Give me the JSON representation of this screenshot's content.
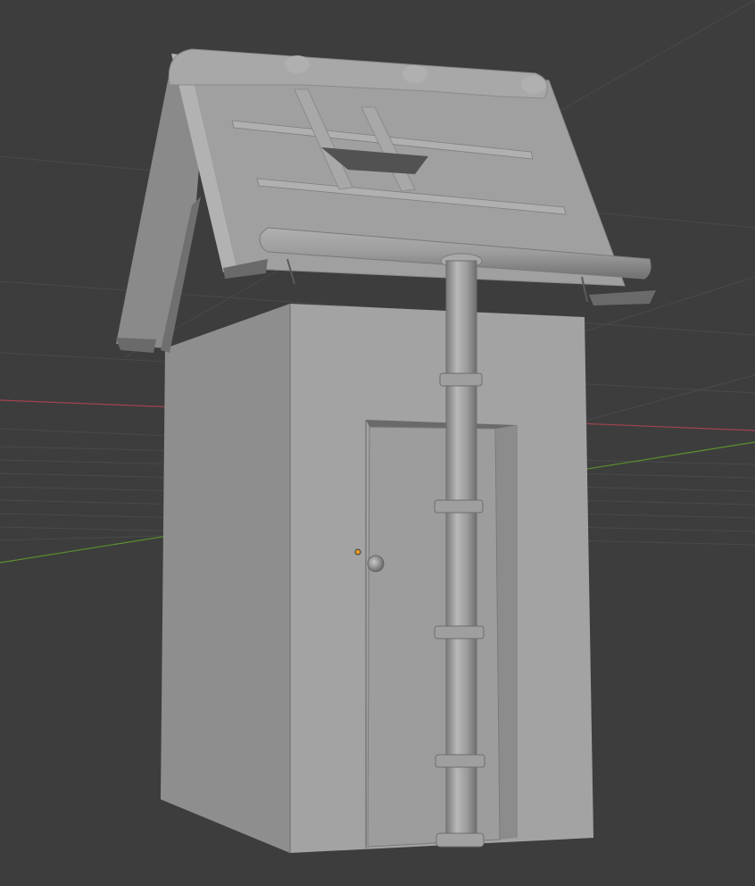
{
  "viewport": {
    "mode": "solid",
    "background_color": "#3d3d3d",
    "grid_color": "#4a4a4a",
    "x_axis_color": "#a0444f",
    "y_axis_color": "#5c8f2e",
    "origin_color": "#e79a23"
  },
  "object": {
    "name": "outhouse",
    "parts": [
      "roof",
      "roof-planks",
      "gutter",
      "drainpipe",
      "pipe-clamps",
      "walls",
      "door",
      "door-knob"
    ],
    "surface_color": "#9a9a9a",
    "shade_color": "#7e7e7e",
    "highlight_color": "#b5b5b5"
  }
}
